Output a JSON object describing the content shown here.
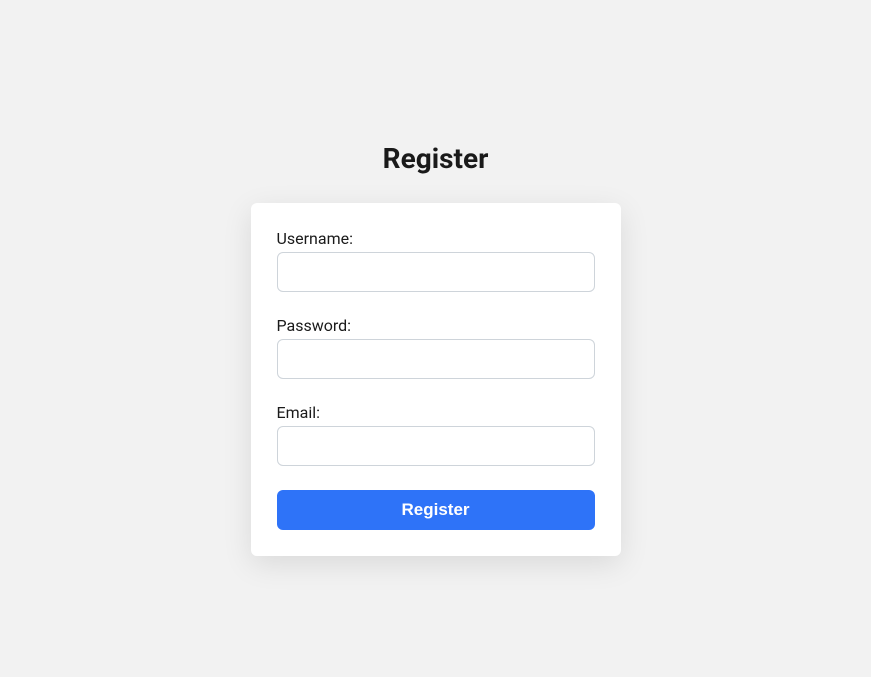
{
  "page": {
    "title": "Register"
  },
  "form": {
    "username": {
      "label": "Username:",
      "value": ""
    },
    "password": {
      "label": "Password:",
      "value": ""
    },
    "email": {
      "label": "Email:",
      "value": ""
    },
    "submit_label": "Register"
  }
}
